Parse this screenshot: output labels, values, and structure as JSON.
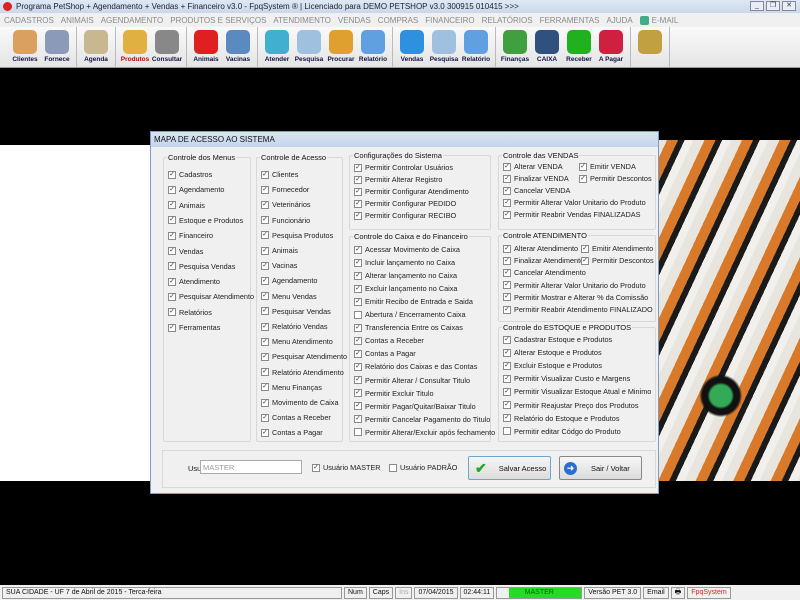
{
  "window": {
    "title": "Programa PetShop + Agendamento + Vendas + Financeiro v3.0 - FpqSystem ® | Licenciado para  DEMO PETSHOP v3.0 300915 010415 >>>"
  },
  "menu": [
    "CADASTROS",
    "ANIMAIS",
    "AGENDAMENTO",
    "PRODUTOS E SERVIÇOS",
    "ATENDIMENTO",
    "VENDAS",
    "COMPRAS",
    "FINANCEIRO",
    "RELATÓRIOS",
    "FERRAMENTAS",
    "AJUDA"
  ],
  "menu_email": "E-MAIL",
  "toolbar": [
    {
      "label": "Clientes",
      "color": "#d9a060"
    },
    {
      "label": "Fornece",
      "color": "#c98a50"
    }
  ],
  "toolbar_groups": [
    [
      {
        "label": "Clientes",
        "color": "#d9a060"
      },
      {
        "label": "Fornece",
        "color": "#8a9ab8"
      }
    ],
    [
      {
        "label": "Agenda",
        "color": "#c8b890"
      }
    ],
    [
      {
        "label": "Produtos",
        "color": "#e0b040"
      },
      {
        "label": "Consultar",
        "color": "#888"
      }
    ],
    [
      {
        "label": "Animais",
        "color": "#e02020"
      },
      {
        "label": "Vacinas",
        "color": "#5a8ac0"
      }
    ],
    [
      {
        "label": "Atender",
        "color": "#40b0d0"
      },
      {
        "label": "Pesquisa",
        "color": "#a0c0e0"
      },
      {
        "label": "Procurar",
        "color": "#e0a030"
      },
      {
        "label": "Relatório",
        "color": "#60a0e0"
      }
    ],
    [
      {
        "label": "Vendas",
        "color": "#3090e0"
      },
      {
        "label": "Pesquisa",
        "color": "#a0c0e0"
      },
      {
        "label": "Relatório",
        "color": "#60a0e0"
      }
    ],
    [
      {
        "label": "Finanças",
        "color": "#40a040"
      },
      {
        "label": "CAIXA",
        "color": "#305080"
      },
      {
        "label": "Receber",
        "color": "#20b020"
      },
      {
        "label": "A Pagar",
        "color": "#d02040"
      }
    ],
    [
      {
        "label": "",
        "color": "#c0a040"
      }
    ]
  ],
  "dialog": {
    "title": "MAPA DE ACESSO AO SISTEMA",
    "groups": {
      "menus": {
        "title": "Controle dos Menus",
        "items": [
          [
            "Cadastros",
            true
          ],
          [
            "Agendamento",
            true
          ],
          [
            "Animais",
            true
          ],
          [
            "Estoque e Produtos",
            true
          ],
          [
            "Financeiro",
            true
          ],
          [
            "Vendas",
            true
          ],
          [
            "Pesquisa Vendas",
            true
          ],
          [
            "Atendimento",
            true
          ],
          [
            "Pesquisar Atendimento",
            true
          ],
          [
            "Relatórios",
            true
          ],
          [
            "Ferramentas",
            true
          ]
        ]
      },
      "acesso": {
        "title": "Controle de Acesso",
        "items": [
          [
            "Clientes",
            true
          ],
          [
            "Fornecedor",
            true
          ],
          [
            "Veterinários",
            true
          ],
          [
            "Funcionário",
            true
          ],
          [
            "Pesquisa Produtos",
            true
          ],
          [
            "Animais",
            true
          ],
          [
            "Vacinas",
            true
          ],
          [
            "Agendamento",
            true
          ],
          [
            "Menu Vendas",
            true
          ],
          [
            "Pesquisar Vendas",
            true
          ],
          [
            "Relatório Vendas",
            true
          ],
          [
            "Menu Atendimento",
            true
          ],
          [
            "Pesquisar Atendimento",
            true
          ],
          [
            "Relatório Atendimento",
            true
          ],
          [
            "Menu Finanças",
            true
          ],
          [
            "Movimento de Caixa",
            true
          ],
          [
            "Contas a Receber",
            true
          ],
          [
            "Contas a Pagar",
            true
          ]
        ]
      },
      "sistema": {
        "title": "Configurações do Sistema",
        "items": [
          [
            "Permitir Controlar Usuários",
            true
          ],
          [
            "Permitir Alterar Registro",
            true
          ],
          [
            "Permitir Configurar Atendimento",
            true
          ],
          [
            "Permitir Configurar PEDIDO",
            true
          ],
          [
            "Permitir Configurar RECIBO",
            true
          ]
        ]
      },
      "caixa": {
        "title": "Controle do Caixa e do Financeiro",
        "items": [
          [
            "Acessar Movimento de Caixa",
            true
          ],
          [
            "Incluir lançamento no Caixa",
            true
          ],
          [
            "Alterar lançamento no Caixa",
            true
          ],
          [
            "Excluir lançamento no Caixa",
            true
          ],
          [
            "Emitir Recibo de Entrada e Saida",
            true
          ],
          [
            "Abertura / Encerramento Caixa",
            false
          ],
          [
            "Transferencia Entre os Caixas",
            true
          ],
          [
            "Contas a Receber",
            true
          ],
          [
            "Contas a Pagar",
            true
          ],
          [
            "Relatório dos Caixas e das Contas",
            true
          ],
          [
            "Permitir Alterar / Consultar Titulo",
            true
          ],
          [
            "Permitir Excluir Titulo",
            true
          ],
          [
            "Permitir Pagar/Quitar/Baixar Titulo",
            true
          ],
          [
            "Permitir Cancelar Pagamento do Titulo",
            true
          ],
          [
            "Permitir Alterar/Excluir após fechamento",
            false
          ]
        ]
      },
      "vendas": {
        "title": "Controle das VENDAS",
        "items": [
          [
            "Alterar VENDA",
            true
          ],
          [
            "Emitir VENDA",
            true
          ],
          [
            "Finalizar VENDA",
            true
          ],
          [
            "Permitir Descontos",
            true
          ],
          [
            "Cancelar VENDA",
            true
          ],
          [
            "Permitir Alterar Valor Unitario do Produto",
            true
          ],
          [
            "Permitir Reabrir Vendas FINALIZADAS",
            true
          ]
        ]
      },
      "atendimento": {
        "title": "Controle ATENDIMENTO",
        "items": [
          [
            "Alterar Atendimento",
            true
          ],
          [
            "Emitir Atendimento",
            true
          ],
          [
            "Finalizar Atendimento",
            true
          ],
          [
            "Permitir Descontos",
            true
          ],
          [
            "Cancelar Atendimento",
            true
          ],
          [
            "Permitir Alterar Valor Unitario do Produto",
            true
          ],
          [
            "Permitir Mostrar e Alterar % da Comissão",
            true
          ],
          [
            "Permitir Reabrir Atendimento FINALIZADO",
            true
          ]
        ]
      },
      "estoque": {
        "title": "Controle do ESTOQUE e PRODUTOS",
        "items": [
          [
            "Cadastrar Estoque e Produtos",
            true
          ],
          [
            "Alterar Estoque e Produtos",
            true
          ],
          [
            "Excluir Estoque e Produtos",
            true
          ],
          [
            "Permitir Visualizar Custo e Margens",
            true
          ],
          [
            "Permitir Visualizar Estoque Atual e Minimo",
            true
          ],
          [
            "Permitir Reajustar Preço dos Produtos",
            true
          ],
          [
            "Relatório do Estoque e Produtos",
            true
          ],
          [
            "Permitir editar Códgo do Produto",
            false
          ]
        ]
      }
    },
    "usuario_label": "Usuário:",
    "usuario_value": "MASTER",
    "master_label": "Usuário MASTER",
    "master_checked": true,
    "padrao_label": "Usuário PADRÃO",
    "padrao_checked": false,
    "save_label": "Salvar Acesso",
    "exit_label": "Sair / Voltar"
  },
  "statusbar": {
    "location": "SUA CIDADE - UF  7 de Abril de 2015 - Terca-feira",
    "num": "Num",
    "caps": "Caps",
    "ins": "Ins",
    "date": "07/04/2015",
    "time": "02:44:11",
    "user": "MASTER",
    "version": "Versão PET 3.0",
    "email": "Email",
    "brand": "FpqSystem"
  }
}
